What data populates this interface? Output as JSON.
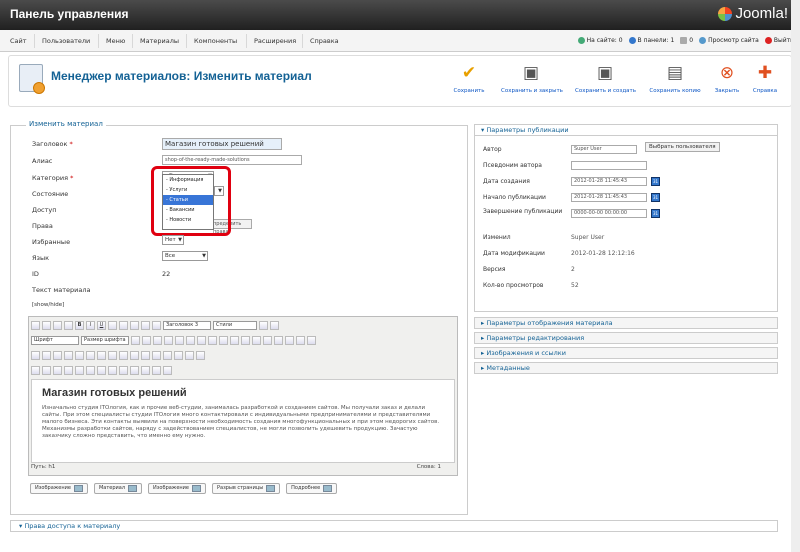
{
  "header": {
    "title": "Панель управления",
    "logo": "Joomla!"
  },
  "menu": [
    "Сайт",
    "Пользователи",
    "Меню",
    "Материалы",
    "Компоненты",
    "Расширения",
    "Справка"
  ],
  "status": {
    "on_site": "На сайте: 0",
    "in_panel": "В панели: 1",
    "messages": "0",
    "view_site": "Просмотр сайта",
    "logout": "Выйти"
  },
  "toolbar": {
    "page_title": "Менеджер материалов: Изменить материал",
    "buttons": [
      {
        "label": "Сохранить",
        "icon": "check-icon",
        "color": "#e8a000"
      },
      {
        "label": "Сохранить и закрыть",
        "icon": "save-close-icon",
        "color": "#555555"
      },
      {
        "label": "Сохранить и создать",
        "icon": "save-new-icon",
        "color": "#555555"
      },
      {
        "label": "Сохранить копию",
        "icon": "save-copy-icon",
        "color": "#555555"
      },
      {
        "label": "Закрыть",
        "icon": "close-icon",
        "color": "#e05020"
      },
      {
        "label": "Справка",
        "icon": "help-icon",
        "color": "#e05020"
      }
    ]
  },
  "form": {
    "legend": "Изменить материал",
    "title_label": "Заголовок",
    "title_value": "Магазин готовых решений",
    "alias_label": "Алиас",
    "alias_value": "shop-of-the-ready-made-solutions",
    "category_label": "Категория",
    "category_value": "- Статьи",
    "state_label": "Состояние",
    "access_label": "Доступ",
    "rights_label": "Права",
    "rights_button": "пределить права",
    "featured_label": "Избранные",
    "featured_value": "Нет",
    "language_label": "Язык",
    "language_value": "Все",
    "id_label": "ID",
    "id_value": "22",
    "text_label": "Текст материала",
    "showhide": "[show/hide]",
    "category_options": [
      "- Информация",
      "- Услуги",
      "- Статьи",
      "- Вакансии",
      "- Новости"
    ],
    "category_selected_index": 2
  },
  "editor": {
    "format_value": "Заголовок 3",
    "style_value": "Стили",
    "font_value": "Шрифт",
    "size_value": "Размер шрифта",
    "heading": "Магазин готовых решений",
    "body": "Изначально студия ITОлогия, как и прочие веб-студии, занималась разработкой и созданием сайтов. Мы получали заказ и делали сайты. При этом специалисты студии ITОлогия много контактировали с индивидуальными предпринимателями и представителями малого бизнеса. Эти контакты выявили на поверхности необходимость создания многофункциональных и при этом недорогих сайтов. Механизмы разработки сайтов, наряду с задействованием специалистов, не могли позволить удешевить продукцию. Зачастую заказчику сложно представить, что именно ему нужно.",
    "path": "Путь: h1",
    "word_count": "Слова: 1"
  },
  "editor_buttons": [
    "Изображение",
    "Материал",
    "Изображение",
    "Разрыв страницы",
    "Подробнее"
  ],
  "publishing": {
    "header": "Параметры публикации",
    "author_label": "Автор",
    "author_value": "Super User",
    "select_user": "Выбрать пользователя",
    "alias_author_label": "Псевдоним автора",
    "created_label": "Дата создания",
    "created_value": "2012-01-28 11:45:43",
    "publish_up_label": "Начало публикации",
    "publish_up_value": "2012-01-28 11:45:43",
    "publish_down_label": "Завершение публикации",
    "publish_down_value": "0000-00-00 00:00:00",
    "modified_by_label": "Изменил",
    "modified_by_value": "Super User",
    "modified_label": "Дата модификации",
    "modified_value": "2012-01-28 12:12:16",
    "version_label": "Версия",
    "version_value": "2",
    "hits_label": "Кол-во просмотров",
    "hits_value": "52"
  },
  "accordion": [
    "Параметры отображения материала",
    "Параметры редактирования",
    "Изображения и ссылки",
    "Метаданные"
  ],
  "access_section": "Права доступа к материалу"
}
